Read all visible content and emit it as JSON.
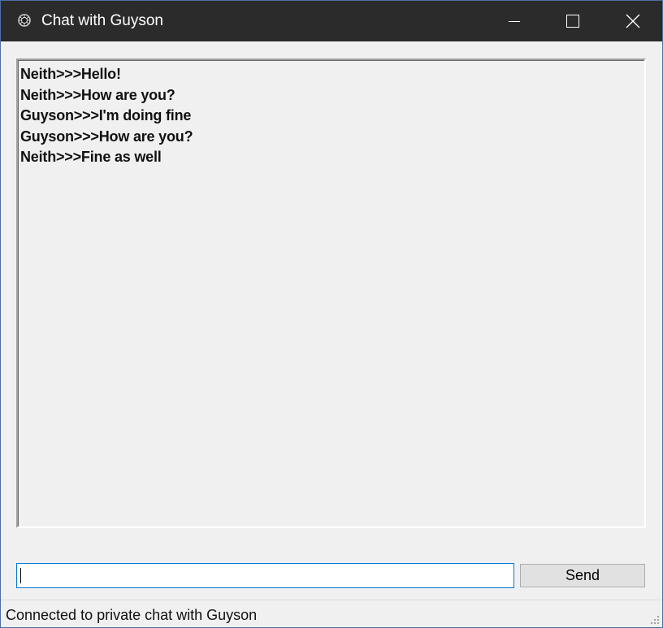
{
  "window": {
    "title": "Chat with Guyson",
    "controls": {
      "minimize": "minimize-icon",
      "maximize": "maximize-icon",
      "close": "close-icon"
    }
  },
  "chat": {
    "messages": [
      "Neith>>>Hello!",
      "Neith>>>How are you?",
      "Guyson>>>I'm doing fine",
      "Guyson>>>How are you?",
      "Neith>>>Fine as well"
    ]
  },
  "composer": {
    "input_value": "",
    "send_label": "Send"
  },
  "status": {
    "text": "Connected to private chat with Guyson"
  },
  "colors": {
    "titlebar": "#2b2b2b",
    "window_bg": "#f0f0f0",
    "focus_border": "#0078d7"
  }
}
